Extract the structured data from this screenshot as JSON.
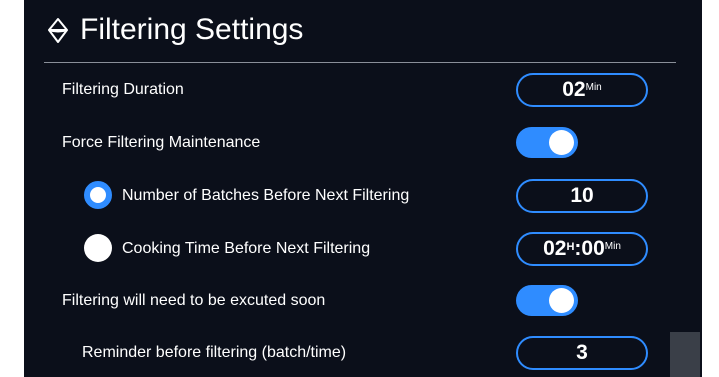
{
  "header": {
    "title": "Filtering Settings",
    "icon": "filter-funnel-icon"
  },
  "rows": {
    "duration": {
      "label": "Filtering Duration",
      "value": "02",
      "unit": "Min"
    },
    "force_maintenance": {
      "label": "Force Filtering Maintenance",
      "enabled": true
    },
    "batches": {
      "label": "Number of Batches Before Next Filtering",
      "value": "10",
      "selected": true
    },
    "cooking_time": {
      "label": "Cooking Time Before Next Filtering",
      "hours": "02",
      "hours_unit": "H",
      "minutes": ":00",
      "minutes_unit": "Min",
      "selected": false
    },
    "soon": {
      "label": "Filtering will need to be excuted soon",
      "enabled": true
    },
    "reminder": {
      "label": "Reminder before filtering (batch/time)",
      "value": "3"
    }
  },
  "colors": {
    "background": "#0b0f1a",
    "accent": "#2f8cff",
    "text": "#ffffff",
    "divider": "#8a8f99"
  }
}
